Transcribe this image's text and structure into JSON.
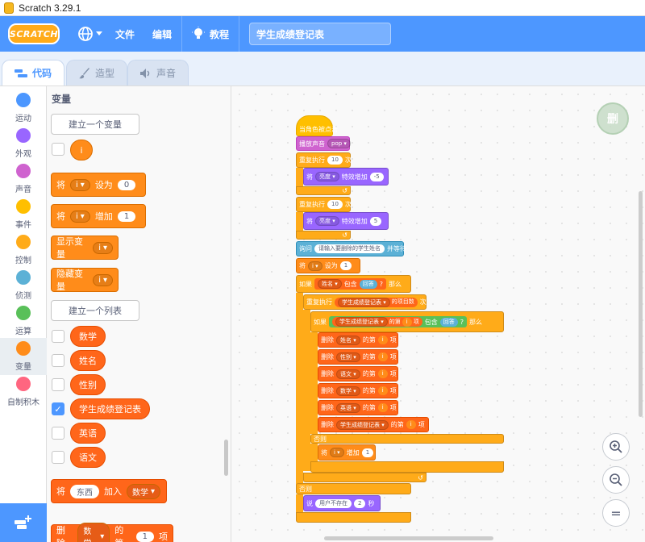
{
  "window": {
    "title": "Scratch 3.29.1"
  },
  "menubar": {
    "logo": "SCRATCH",
    "file": "文件",
    "edit": "编辑",
    "tutorials": "教程",
    "project_title": "学生成绩登记表"
  },
  "tabs": [
    {
      "label": "代码",
      "icon": "code-icon",
      "active": true
    },
    {
      "label": "造型",
      "icon": "brush-icon",
      "active": false
    },
    {
      "label": "声音",
      "icon": "speaker-icon",
      "active": false
    }
  ],
  "categories": [
    {
      "label": "运动",
      "color": "#4c97ff"
    },
    {
      "label": "外观",
      "color": "#9966ff"
    },
    {
      "label": "声音",
      "color": "#cf63cf"
    },
    {
      "label": "事件",
      "color": "#ffbf00"
    },
    {
      "label": "控制",
      "color": "#ffab19"
    },
    {
      "label": "侦测",
      "color": "#5cb1d6"
    },
    {
      "label": "运算",
      "color": "#59c059"
    },
    {
      "label": "变量",
      "color": "#ff8c1a"
    },
    {
      "label": "自制积木",
      "color": "#ff6680"
    }
  ],
  "palette": {
    "heading": "变量",
    "make_variable": "建立一个变量",
    "variable_name": "i",
    "set_block": {
      "prefix": "将",
      "var": "i",
      "middle": "设为",
      "value": "0"
    },
    "change_block": {
      "prefix": "将",
      "var": "i",
      "middle": "增加",
      "value": "1"
    },
    "show_block": {
      "label": "显示变量",
      "var": "i"
    },
    "hide_block": {
      "label": "隐藏变量",
      "var": "i"
    },
    "make_list": "建立一个列表",
    "lists": [
      "数学",
      "姓名",
      "性别",
      "学生成绩登记表",
      "英语",
      "语文"
    ],
    "add_block": {
      "prefix": "将",
      "value": "东西",
      "middle": "加入",
      "list": "数学"
    },
    "delete_block": {
      "prefix": "删除",
      "list": "数学",
      "middle": "的第",
      "value": "1",
      "suffix": "项"
    }
  },
  "script": {
    "hat": "当角色被点击",
    "play_sound": {
      "label": "播放声音",
      "sound": "pop"
    },
    "repeat1": {
      "label": "重复执行",
      "times": "10",
      "suffix": "次"
    },
    "effect1": {
      "prefix": "将",
      "effect": "亮度",
      "middle": "特效增加",
      "value": "-5"
    },
    "repeat2": {
      "label": "重复执行",
      "times": "10",
      "suffix": "次"
    },
    "effect2": {
      "prefix": "将",
      "effect": "亮度",
      "middle": "特效增加",
      "value": "5"
    },
    "ask": {
      "label": "询问",
      "question": "请输入要删除的学生姓名",
      "suffix": "并等待"
    },
    "set_i": {
      "prefix": "将",
      "var": "i",
      "middle": "设为",
      "value": "1"
    },
    "if_outer": {
      "label": "如果",
      "list": "姓名",
      "contains": "包含",
      "answer": "回答",
      "q": "?",
      "then": "那么"
    },
    "repeat3": {
      "label": "重复执行",
      "list": "学生成绩登记表",
      "item_count": "的项目数",
      "suffix": "次"
    },
    "if_inner": {
      "label": "如果",
      "list": "学生成绩登记表",
      "of": "的第",
      "var": "i",
      "item": "项",
      "contains": "包含",
      "answer": "回答",
      "q": "?",
      "then": "那么"
    },
    "deletes": [
      {
        "list": "姓名"
      },
      {
        "list": "性别"
      },
      {
        "list": "语文"
      },
      {
        "list": "数学"
      },
      {
        "list": "英语"
      },
      {
        "list": "学生成绩登记表"
      }
    ],
    "delete_prefix": "删除",
    "delete_of": "的第",
    "delete_var": "i",
    "delete_item": "项",
    "else_label": "否则",
    "change_i": {
      "prefix": "将",
      "var": "i",
      "middle": "增加",
      "value": "1"
    },
    "else_outer": "否则",
    "say": {
      "label": "说",
      "message": "用户不存在",
      "secs": "2",
      "suffix": "秒"
    }
  },
  "trash_label": "删",
  "zoom": {
    "in": "+",
    "out": "−",
    "reset": "="
  }
}
